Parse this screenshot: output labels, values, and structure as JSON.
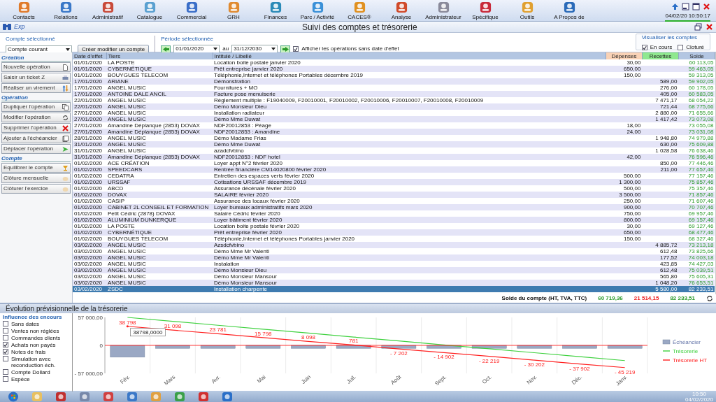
{
  "toolbar": {
    "items": [
      {
        "label": "Contacts"
      },
      {
        "label": "Relations"
      },
      {
        "label": "Administratif"
      },
      {
        "label": "Catalogue"
      },
      {
        "label": "Commercial"
      },
      {
        "label": "GRH"
      },
      {
        "label": "Finances"
      },
      {
        "label": "Parc / Activité"
      },
      {
        "label": "CACES®"
      },
      {
        "label": "Analyse"
      },
      {
        "label": "Administrateur"
      },
      {
        "label": "Spécifique"
      },
      {
        "label": "Outils"
      },
      {
        "label": "A Propos de"
      }
    ],
    "datetime": "04/02/20 10:50:17"
  },
  "window": {
    "logo": "Exp",
    "title": "Suivi des comptes et trésorerie"
  },
  "filters": {
    "account_label": "Compte sélectionné",
    "account": "Compte courant",
    "account_button": "Créer modifier un compte",
    "period_label": "Période sélectionnée",
    "date_from": "01/01/2020",
    "between": "au",
    "date_to": "31/12/2030",
    "show_undated": {
      "label": "Afficher les opérations sans date d'effet",
      "checked": true
    },
    "view": {
      "title": "Visualiser les comptes",
      "options": [
        {
          "label": "En cours",
          "checked": true
        },
        {
          "label": "Cloturé",
          "checked": false
        }
      ]
    }
  },
  "sidebar": {
    "sections": [
      {
        "title": "Création",
        "buttons": [
          "Nouvelle opération",
          "Saisir un ticket Z",
          "Réaliser un virement"
        ]
      },
      {
        "title": "Opération",
        "buttons": [
          "Dupliquer l'opération",
          "Modifier l'opération",
          "Supprimer l'opération",
          "Ajouter à l'échéancier",
          "Déplacer l'opération"
        ]
      },
      {
        "title": "Compte",
        "buttons": [
          "Equilibrer le compte",
          "Clôture mensuelle",
          "Clôturer l'exercice"
        ]
      }
    ]
  },
  "table": {
    "columns": [
      "Date d'effet",
      "Tiers",
      "Intitulé / Libellé",
      "Dépenses",
      "Recettes",
      "Solde"
    ],
    "rows": [
      {
        "date": "01/01/2020",
        "tiers": "LA POSTE",
        "libelle": "Location boite postale janvier 2020",
        "depenses": "30,00",
        "solde": "60 113,05",
        "selected": false
      },
      {
        "date": "01/01/2020",
        "tiers": "CYBERNÉTIQUE",
        "libelle": "Prêt entreprise janvier 2020",
        "depenses": "650,00",
        "solde": "59 463,05",
        "selected": false
      },
      {
        "date": "01/01/2020",
        "tiers": "BOUYGUES TELECOM",
        "libelle": "Téléphonie,Internet et téléphones Portables décembre 2019",
        "depenses": "150,00",
        "solde": "59 313,05",
        "selected": false
      },
      {
        "date": "17/01/2020",
        "tiers": "ARIANE",
        "libelle": "Démonstration",
        "recettes": "589,00",
        "solde": "59 902,05",
        "selected": false
      },
      {
        "date": "17/01/2020",
        "tiers": "ANGEL MUSIC",
        "libelle": "Fournitures + MO",
        "recettes": "276,00",
        "solde": "60 178,05",
        "selected": false
      },
      {
        "date": "17/01/2020",
        "tiers": "ANTOINE DALE ANCIL",
        "libelle": "Facture pose menuiserie",
        "recettes": "405,00",
        "solde": "60 583,05",
        "selected": false
      },
      {
        "date": "22/01/2020",
        "tiers": "ANGEL MUSIC",
        "libelle": "Règlement multiple : F19040009, F20010001, F20010002, F20010006, F20010007, F20010008, F20010009",
        "recettes": "7 471,17",
        "solde": "68 054,22",
        "selected": false
      },
      {
        "date": "22/01/2020",
        "tiers": "ANGEL MUSIC",
        "libelle": "Démo Monsieur Dieu",
        "recettes": "721,44",
        "solde": "68 775,66",
        "selected": false
      },
      {
        "date": "27/01/2020",
        "tiers": "ANGEL MUSIC",
        "libelle": "Installation radiateur",
        "recettes": "2 880,00",
        "solde": "71 655,66",
        "selected": false
      },
      {
        "date": "27/01/2020",
        "tiers": "ANGEL MUSIC",
        "libelle": "Démo Mme Duwat",
        "recettes": "1 417,42",
        "solde": "73 073,08",
        "selected": false
      },
      {
        "date": "27/01/2020",
        "tiers": "Amandine Déplanque (2853) DOVAX",
        "libelle": "NDF20012853 : Péage",
        "depenses": "18,00",
        "solde": "73 055,08",
        "selected": false
      },
      {
        "date": "27/01/2020",
        "tiers": "Amandine Déplanque (2853) DOVAX",
        "libelle": "NDF20012853 : Amandine",
        "depenses": "24,00",
        "solde": "73 031,08",
        "selected": false
      },
      {
        "date": "28/01/2020",
        "tiers": "ANGEL MUSIC",
        "libelle": "Démo Madame Frias",
        "recettes": "1 948,80",
        "solde": "74 979,88",
        "selected": false
      },
      {
        "date": "31/01/2020",
        "tiers": "ANGEL MUSIC",
        "libelle": "Démo Mme Duwat",
        "recettes": "630,00",
        "solde": "75 609,88",
        "selected": false
      },
      {
        "date": "31/01/2020",
        "tiers": "ANGEL MUSIC",
        "libelle": "azadcfvbino",
        "recettes": "1 028,58",
        "solde": "76 638,46",
        "selected": false
      },
      {
        "date": "31/01/2020",
        "tiers": "Amandine Déplanque (2853) DOVAX",
        "libelle": "NDF20012853 : NDF hotel",
        "depenses": "42,00",
        "solde": "76 596,46",
        "selected": false
      },
      {
        "date": "01/02/2020",
        "tiers": "ACE CRÉATION",
        "libelle": "Loyer appt N°2 février 2020",
        "recettes": "850,00",
        "solde": "77 446,46",
        "selected": false
      },
      {
        "date": "01/02/2020",
        "tiers": "SPEEDCARS",
        "libelle": "Rentrée financière CM14020800 février 2020",
        "recettes": "211,00",
        "solde": "77 657,46",
        "selected": false
      },
      {
        "date": "01/02/2020",
        "tiers": "CEDATRA",
        "libelle": "Entretien des espaces verts février 2020",
        "depenses": "500,00",
        "solde": "77 157,46",
        "selected": false
      },
      {
        "date": "01/02/2020",
        "tiers": "URSSAF",
        "libelle": "Cotisations URSSAF décembre 2019",
        "depenses": "1 300,00",
        "solde": "75 857,46",
        "selected": false
      },
      {
        "date": "01/02/2020",
        "tiers": "ABCD",
        "libelle": "Assurance décénale février 2020",
        "depenses": "500,00",
        "solde": "75 357,46",
        "selected": false
      },
      {
        "date": "01/02/2020",
        "tiers": "DOVAX",
        "libelle": "SALAIRE février 2020",
        "depenses": "3 500,00",
        "solde": "71 857,46",
        "selected": false
      },
      {
        "date": "01/02/2020",
        "tiers": "CASIP",
        "libelle": "Assurance des locaux février 2020",
        "depenses": "250,00",
        "solde": "71 607,46",
        "selected": false
      },
      {
        "date": "01/02/2020",
        "tiers": "CABINET 2L CONSEIL ET FORMATION",
        "libelle": "Loyer bureaux administratifs mars 2020",
        "depenses": "900,00",
        "solde": "70 707,46",
        "selected": false
      },
      {
        "date": "01/02/2020",
        "tiers": "Petit Cédric (2878) DOVAX",
        "libelle": "Salaire Cédric février 2020",
        "depenses": "750,00",
        "solde": "69 957,46",
        "selected": false
      },
      {
        "date": "01/02/2020",
        "tiers": "ALUMINIUM DUNKERQUE",
        "libelle": "Loyer bâtiment février 2020",
        "depenses": "800,00",
        "solde": "69 157,46",
        "selected": false
      },
      {
        "date": "01/02/2020",
        "tiers": "LA POSTE",
        "libelle": "Location boite postale février 2020",
        "depenses": "30,00",
        "solde": "69 127,46",
        "selected": false
      },
      {
        "date": "01/02/2020",
        "tiers": "CYBERNÉTIQUE",
        "libelle": "Prêt entreprise février 2020",
        "depenses": "650,00",
        "solde": "68 477,46",
        "selected": false
      },
      {
        "date": "01/02/2020",
        "tiers": "BOUYGUES TELECOM",
        "libelle": "Téléphonie,Internet et téléphones Portables janvier 2020",
        "depenses": "150,00",
        "solde": "68 327,46",
        "selected": false
      },
      {
        "date": "03/02/2020",
        "tiers": "ANGEL MUSIC",
        "libelle": "Azsdcfvbino",
        "recettes": "4 885,72",
        "solde": "73 213,18",
        "selected": false
      },
      {
        "date": "03/02/2020",
        "tiers": "ANGEL MUSIC",
        "libelle": "Démo Mme Mr Valenti",
        "recettes": "612,48",
        "solde": "73 825,66",
        "selected": false
      },
      {
        "date": "03/02/2020",
        "tiers": "ANGEL MUSIC",
        "libelle": "Démo Mme Mr Valenti",
        "recettes": "177,52",
        "solde": "74 003,18",
        "selected": false
      },
      {
        "date": "03/02/2020",
        "tiers": "ANGEL MUSIC",
        "libelle": "Instalation",
        "recettes": "423,85",
        "solde": "74 427,03",
        "selected": false
      },
      {
        "date": "03/02/2020",
        "tiers": "ANGEL MUSIC",
        "libelle": "Démo Monsieur Dieu",
        "recettes": "612,48",
        "solde": "75 039,51",
        "selected": false
      },
      {
        "date": "03/02/2020",
        "tiers": "ANGEL MUSIC",
        "libelle": "Démo Monsieur Mansour",
        "recettes": "565,80",
        "solde": "75 605,31",
        "selected": false
      },
      {
        "date": "03/02/2020",
        "tiers": "ANGEL MUSIC",
        "libelle": "Démo Monsieur Mansour",
        "recettes": "1 048,20",
        "solde": "76 653,51",
        "selected": false
      },
      {
        "date": "03/02/2020",
        "tiers": "ZSDC",
        "libelle": "Installation charpente",
        "recettes": "5 580,00",
        "solde": "82 233,51",
        "selected": true
      }
    ],
    "totals": {
      "label": "Solde du compte  (HT, TVA, TTC)",
      "ht": "60 719,36",
      "tva": "21 514,15",
      "ttc": "82 233,51"
    }
  },
  "forecast": {
    "title": "Évolution prévisionnelle de la trésorerie",
    "influence_title": "Influence des encours",
    "options": [
      {
        "label": "Sans dates",
        "checked": false
      },
      {
        "label": "Ventes non réglées",
        "checked": false
      },
      {
        "label": "Commandes clients",
        "checked": false
      },
      {
        "label": "Achats non payés",
        "checked": true
      },
      {
        "label": "Notes de frais",
        "checked": true
      },
      {
        "label": "Simulation avec reconduction éch.",
        "checked": false
      },
      {
        "label": "Compte Dollard",
        "checked": false
      },
      {
        "label": "Espèce",
        "checked": false
      }
    ],
    "chart_data": {
      "type": "bar",
      "categories": [
        "Fév.",
        "Mars",
        "Avr.",
        "Mai",
        "Juin",
        "Juil.",
        "Août",
        "Sept.",
        "Oct.",
        "Nov.",
        "Déc.",
        "Janv."
      ],
      "ylim": [
        -57000,
        57000
      ],
      "yticks": [
        {
          "value": 57000,
          "label": "57 000,00"
        },
        {
          "value": 0,
          "label": "0"
        },
        {
          "value": -57000,
          "label": "- 57 000,00"
        }
      ],
      "series": [
        {
          "name": "Échéancier",
          "color": "#9aa8c4",
          "values": [
            -24000,
            -6000,
            -6000,
            -6000,
            -6000,
            -6000,
            -6000,
            -6000,
            -6000,
            -6000,
            -6000,
            -6000
          ]
        },
        {
          "name": "Trésorerie",
          "type": "line",
          "color": "#3fd13f",
          "values": [
            57000,
            49000,
            41000,
            33000,
            25000,
            17000,
            9000,
            1000,
            -7000,
            -15000,
            -23000,
            -31000
          ]
        },
        {
          "name": "Trésorerie HT",
          "type": "line",
          "color": "#ff2020",
          "values": [
            38798,
            31098,
            23781,
            15798,
            8098,
            781,
            -7202,
            -14902,
            -22219,
            -30202,
            -37902,
            -45219
          ],
          "value_labels": [
            "38 798",
            "31 098",
            "23 781",
            "15 798",
            "8 098",
            "781",
            "- 7 202",
            "- 14 902",
            "- 22 219",
            "- 30 202",
            "- 37 902",
            "- 45 219"
          ]
        }
      ],
      "annotations": [
        {
          "x": "Fév.",
          "y": 38798,
          "text": "38798,0000"
        }
      ],
      "ref_lines": [
        {
          "axis": "y",
          "value": 0,
          "color": "#ff2020"
        }
      ],
      "legend": "right"
    }
  },
  "taskbar": {
    "time": "10:50",
    "date": "04/02/2020"
  }
}
